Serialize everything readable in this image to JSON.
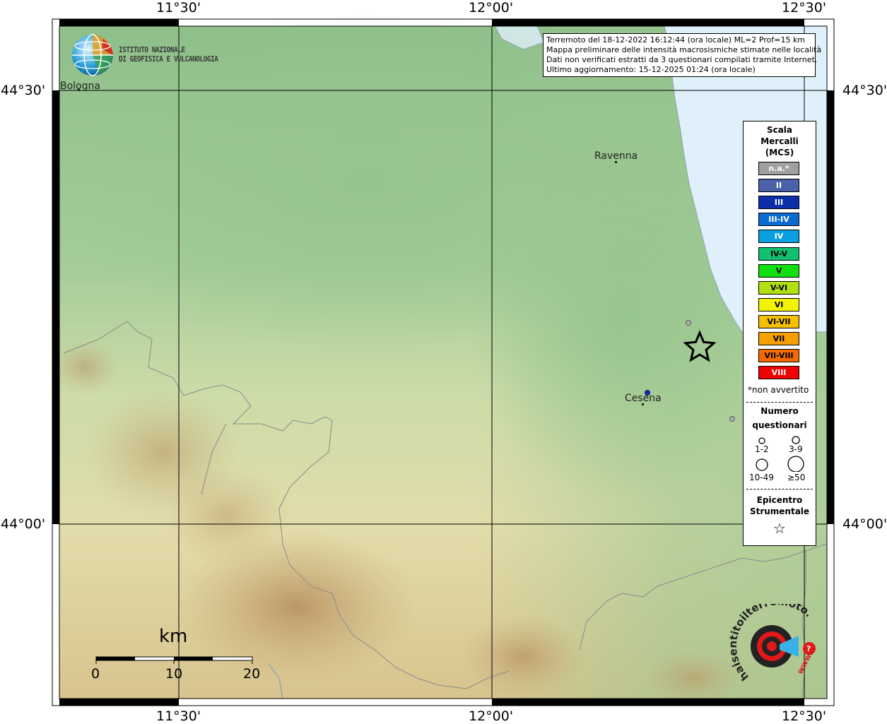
{
  "map": {
    "grid": {
      "x_labels": [
        "11°30'",
        "12°00'",
        "12°30'"
      ],
      "y_labels": [
        "44°30'",
        "44°00'"
      ]
    },
    "info": {
      "line1": "Terremoto del 18-12-2022 16:12:44 (ora locale) ML=2 Prof=15 km",
      "line2": "Mappa preliminare delle intensità macrosismiche stimate nelle località",
      "line3": "Dati non verificati estratti da 3 questionari compilati tramite Internet.",
      "line4": "Ultimo aggiornamento: 15-12-2025 01:24 (ora locale)"
    },
    "institute": {
      "line1": "ISTITUTO NAZIONALE",
      "line2": "DI GEOFISICA E VULCANOLOGIA"
    },
    "cities": {
      "bologna": "Bologna",
      "ravenna": "Ravenna",
      "cesena": "Cesena"
    },
    "scale_bar": {
      "unit": "km",
      "labels": [
        "0",
        "10",
        "20"
      ]
    },
    "legend": {
      "title1": "Scala",
      "title2": "Mercalli",
      "title3": "(MCS)",
      "classes": [
        {
          "label": "n.a.*",
          "color": "#a0a0a0"
        },
        {
          "label": "II",
          "color": "#4a62a8"
        },
        {
          "label": "III",
          "color": "#0a2fa8"
        },
        {
          "label": "III-IV",
          "color": "#0a6cd0"
        },
        {
          "label": "IV",
          "color": "#0aa0e0"
        },
        {
          "label": "IV-V",
          "color": "#10c070"
        },
        {
          "label": "V",
          "color": "#10e010"
        },
        {
          "label": "V-VI",
          "color": "#b0e010"
        },
        {
          "label": "VI",
          "color": "#f4f400"
        },
        {
          "label": "VI-VII",
          "color": "#f4c000"
        },
        {
          "label": "VII",
          "color": "#f4a000"
        },
        {
          "label": "VII-VIII",
          "color": "#f46a00"
        },
        {
          "label": "VIII",
          "color": "#f00000"
        }
      ],
      "not_felt_note": "*non avvertito",
      "count_title1": "Numero",
      "count_title2": "questionari",
      "count_labels": [
        "1-2",
        "3-9",
        "10-49",
        "≥50"
      ],
      "epicenter_title1": "Epicentro",
      "epicenter_title2": "Strumentale"
    },
    "badge": {
      "text": "haisentitoilterremoto.it",
      "www": "www.",
      "question": "?"
    }
  }
}
